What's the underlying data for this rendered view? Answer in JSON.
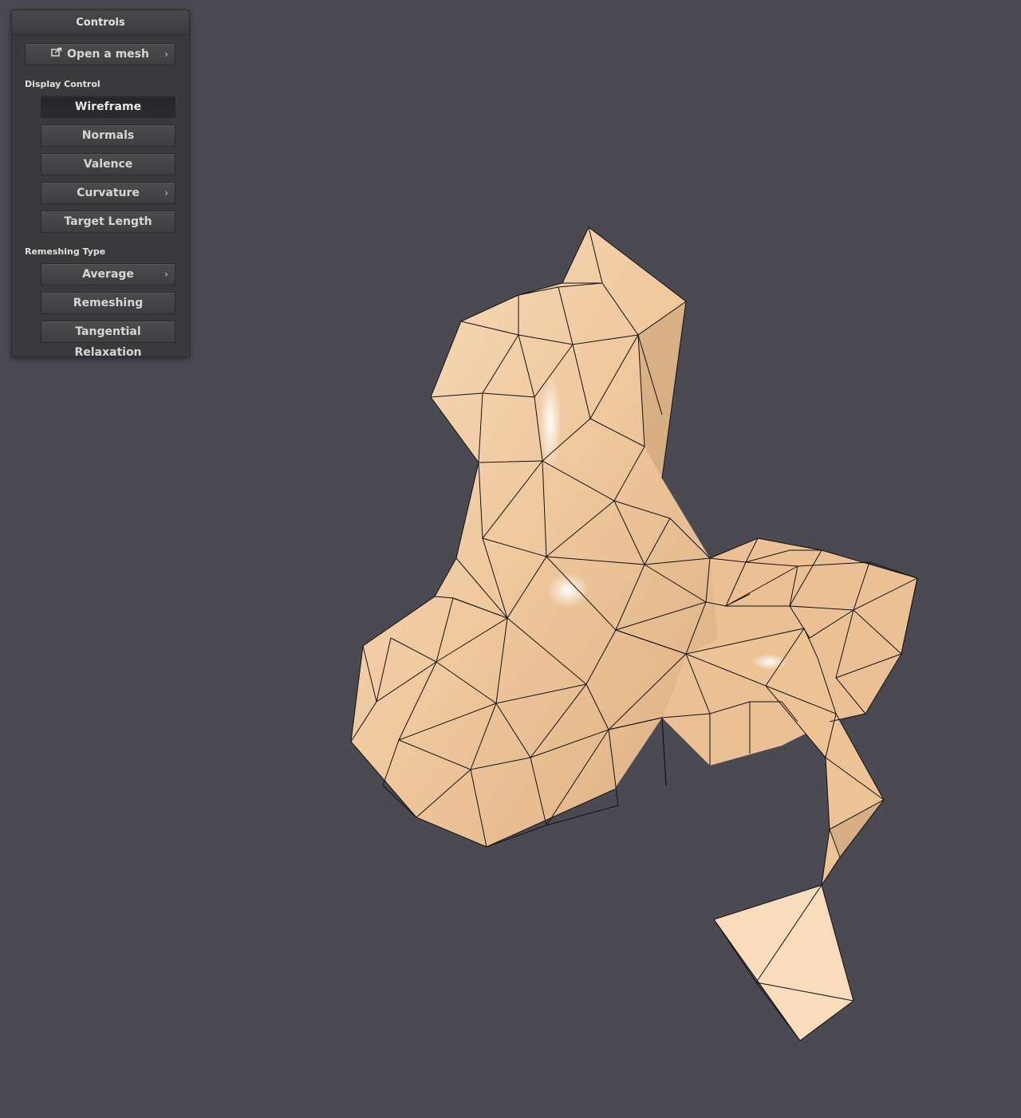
{
  "panel": {
    "title": "Controls",
    "open_mesh_label": "Open a mesh"
  },
  "display_control": {
    "label": "Display Control",
    "buttons": {
      "wireframe": "Wireframe",
      "normals": "Normals",
      "valence": "Valence",
      "curvature": "Curvature",
      "target_length": "Target Length"
    }
  },
  "remeshing_type": {
    "label": "Remeshing Type",
    "buttons": {
      "average": "Average",
      "remeshing": "Remeshing",
      "tangential_relaxation": "Tangential Relaxation"
    }
  },
  "colors": {
    "background": "#4b4a52",
    "panel": "#3a3a3c",
    "mesh_fill": "#f0c9a0",
    "wire": "#111111"
  }
}
